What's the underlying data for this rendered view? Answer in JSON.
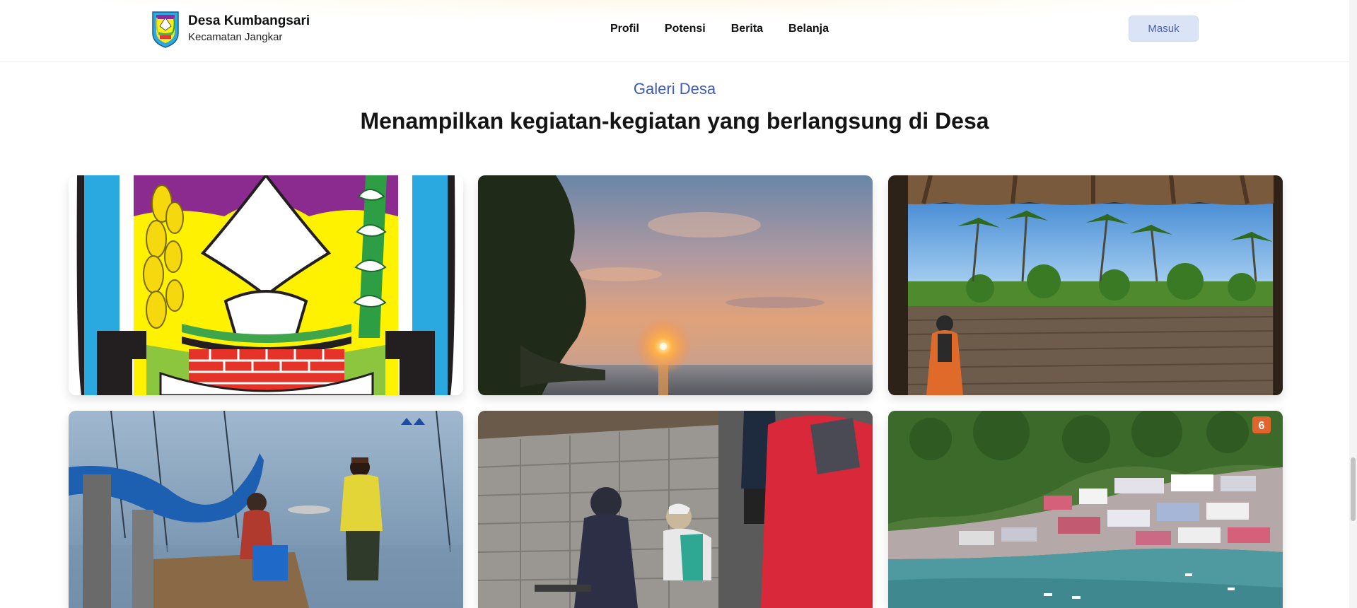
{
  "header": {
    "brand_name": "Desa Kumbangsari",
    "brand_sub": "Kecamatan Jangkar",
    "nav": [
      "Profil",
      "Potensi",
      "Berita",
      "Belanja"
    ],
    "login_label": "Masuk"
  },
  "gallery": {
    "kicker": "Galeri Desa",
    "title": "Menampilkan kegiatan-kegiatan yang berlangsung di Desa",
    "badge_label": "6"
  },
  "colors": {
    "accent": "#3e5bb5",
    "login_bg": "#dbe4f7"
  }
}
